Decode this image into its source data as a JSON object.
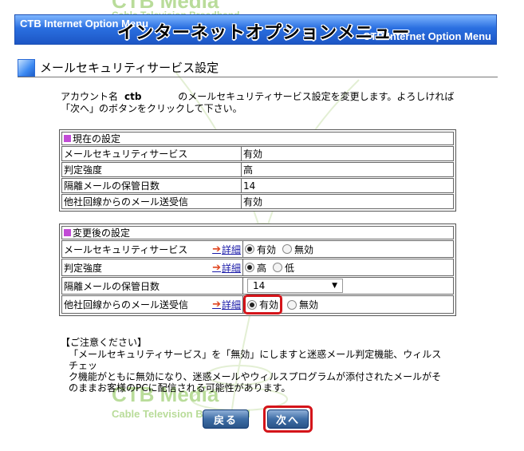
{
  "banner": {
    "small_left": "CTB Internet Option Menu",
    "small_right": "CTB Internet Option Menu",
    "title": "インターネットオプションメニュー"
  },
  "watermark": {
    "top": "CTB Media",
    "top_sub": "Cable Television Broadband",
    "bottom": "CTB Media",
    "bottom_sub": "Cable Television Broadband"
  },
  "section": {
    "title": "メールセキュリティサービス設定"
  },
  "intro": {
    "prefix": "アカウント名",
    "account": "ctb",
    "text1": "のメールセキュリティサービス設定を変更します。よろしければ",
    "text2": "「次へ」のボタンをクリックして下さい。"
  },
  "current": {
    "header": "現在の設定",
    "rows": [
      {
        "label": "メールセキュリティサービス",
        "value": "有効"
      },
      {
        "label": "判定強度",
        "value": "高"
      },
      {
        "label": "隔離メールの保管日数",
        "value": "14"
      },
      {
        "label": "他社回線からのメール送受信",
        "value": "有効"
      }
    ]
  },
  "changed": {
    "header": "変更後の設定",
    "detail_label": "詳細",
    "service": {
      "label": "メールセキュリティサービス",
      "opt_on": "有効",
      "opt_off": "無効",
      "selected": "on"
    },
    "strength": {
      "label": "判定強度",
      "opt_high": "高",
      "opt_low": "低",
      "selected": "high"
    },
    "retention": {
      "label": "隔離メールの保管日数",
      "value": "14"
    },
    "external": {
      "label": "他社回線からのメール送受信",
      "opt_on": "有効",
      "opt_off": "無効",
      "selected": "on"
    }
  },
  "notes": {
    "title": "【ご注意ください】",
    "line1": "「メールセキュリティサービス」を「無効」にしますと迷惑メール判定機能、ウィルスチェッ",
    "line2": "ク機能がともに無効になり、迷惑メールやウィルスプログラムが添付されたメールがそ",
    "line3": "のままお客様のPCに配信される可能性があります。"
  },
  "buttons": {
    "back": "戻る",
    "next": "次へ"
  },
  "colors": {
    "banner": "#2a6fe0",
    "highlight": "#d4141a",
    "marker": "#c24bd6",
    "watermark": "#b9dc9a"
  }
}
